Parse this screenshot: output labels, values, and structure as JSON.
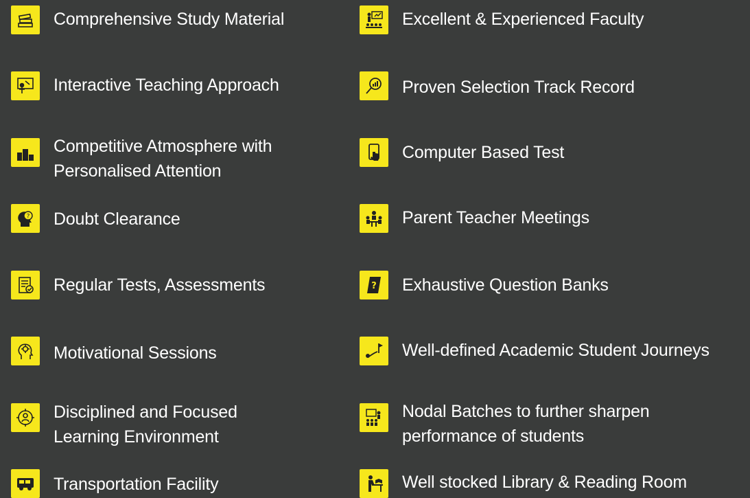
{
  "accent_color": "#f6e71c",
  "background_color": "#3a3c3b",
  "features": [
    {
      "label_lines": [
        "Comprehensive Study Material"
      ],
      "icon": "books-icon"
    },
    {
      "label_lines": [
        "Excellent & Experienced Faculty"
      ],
      "icon": "faculty-icon"
    },
    {
      "label_lines": [
        "Interactive Teaching Approach"
      ],
      "icon": "teacher-board-icon"
    },
    {
      "label_lines": [
        "Proven Selection Track Record"
      ],
      "icon": "magnifier-chart-icon"
    },
    {
      "label_lines": [
        "Competitive Atmosphere with",
        "Personalised Attention"
      ],
      "icon": "podium-icon"
    },
    {
      "label_lines": [
        "Computer Based Test"
      ],
      "icon": "tablet-touch-icon"
    },
    {
      "label_lines": [
        "Doubt Clearance"
      ],
      "icon": "head-question-icon"
    },
    {
      "label_lines": [
        "Parent Teacher Meetings"
      ],
      "icon": "meeting-icon"
    },
    {
      "label_lines": [
        "Regular Tests, Assessments"
      ],
      "icon": "checklist-icon"
    },
    {
      "label_lines": [
        "Exhaustive Question Banks"
      ],
      "icon": "question-book-icon"
    },
    {
      "label_lines": [
        "Motivational Sessions"
      ],
      "icon": "head-gear-icon"
    },
    {
      "label_lines": [
        "Well-defined Academic Student Journeys"
      ],
      "icon": "journey-flag-icon"
    },
    {
      "label_lines": [
        "Disciplined and Focused",
        "Learning Environment"
      ],
      "icon": "focus-target-icon"
    },
    {
      "label_lines": [
        "Nodal Batches to further sharpen",
        "performance of students"
      ],
      "icon": "classroom-icon"
    },
    {
      "label_lines": [
        "Transportation Facility"
      ],
      "icon": "bus-icon"
    },
    {
      "label_lines": [
        "Well stocked Library & Reading Room"
      ],
      "icon": "reading-desk-icon"
    }
  ]
}
